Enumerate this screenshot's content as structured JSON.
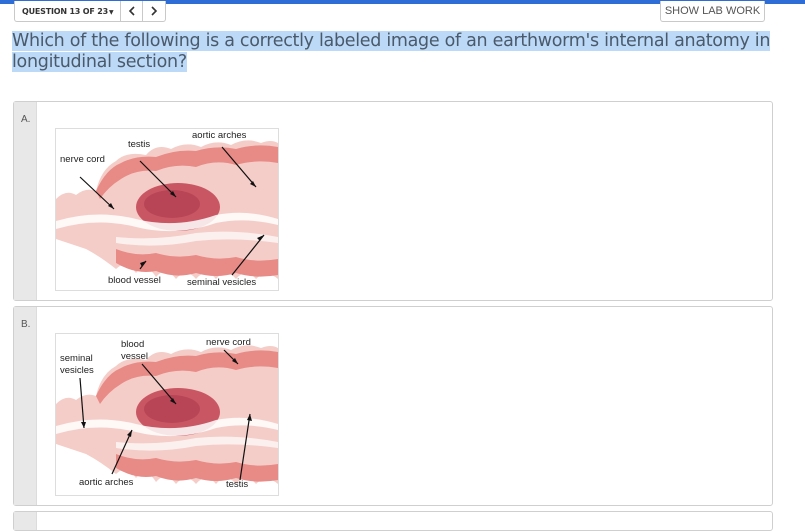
{
  "nav": {
    "question_counter": "QUESTION 13 OF 23",
    "show_lab_work": "SHOW LAB WORK"
  },
  "question": {
    "text": "Which of the following is a correctly labeled image of an earthworm's internal anatomy in longitudinal section?"
  },
  "options": [
    {
      "letter": "A.",
      "labels": {
        "nerve_cord": "nerve cord",
        "testis": "testis",
        "aortic_arches": "aortic arches",
        "blood_vessel": "blood vessel",
        "seminal_vesicles": "seminal vesicles"
      }
    },
    {
      "letter": "B.",
      "labels": {
        "seminal_line1": "seminal",
        "seminal_line2": "vesicles",
        "blood_line1": "blood",
        "blood_line2": "vessel",
        "nerve_cord": "nerve cord",
        "aortic_arches": "aortic arches",
        "testis": "testis"
      }
    }
  ],
  "colors": {
    "accent": "#2e6dd6",
    "highlight": "#bcd9f7",
    "tissue_pink": "#e88a86",
    "tissue_dark": "#c95763",
    "tissue_light": "#f6d6d2"
  }
}
